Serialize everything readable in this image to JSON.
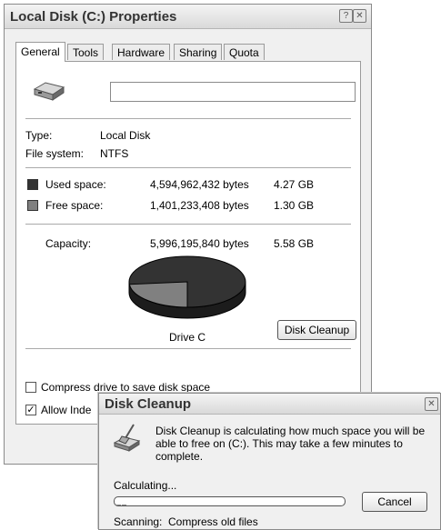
{
  "properties": {
    "title": "Local Disk (C:) Properties",
    "help_icon": "?",
    "close_icon": "✕",
    "tabs": [
      {
        "label": "General"
      },
      {
        "label": "Tools"
      },
      {
        "label": "Hardware"
      },
      {
        "label": "Sharing"
      },
      {
        "label": "Quota"
      }
    ],
    "active_tab": "General",
    "volume_label_value": "",
    "type_label": "Type:",
    "type_value": "Local Disk",
    "fs_label": "File system:",
    "fs_value": "NTFS",
    "used_label": "Used space:",
    "used_bytes": "4,594,962,432 bytes",
    "used_gb": "4.27 GB",
    "free_label": "Free space:",
    "free_bytes": "1,401,233,408 bytes",
    "free_gb": "1.30 GB",
    "capacity_label": "Capacity:",
    "capacity_bytes": "5,996,195,840 bytes",
    "capacity_gb": "5.58 GB",
    "drive_label": "Drive C",
    "disk_cleanup_button": "Disk Cleanup",
    "compress_label": "Compress drive to save disk space",
    "compress_checked": false,
    "index_label": "Allow Inde",
    "index_checked": true,
    "used_fraction": 0.766,
    "colors": {
      "used": "#333333",
      "free": "#808080"
    }
  },
  "cleanup": {
    "title": "Disk Cleanup",
    "close_icon": "✕",
    "message": "Disk Cleanup is calculating how much space you will be able to free on  (C:). This may take a few minutes to complete.",
    "calculating_label": "Calculating...",
    "cancel_button": "Cancel",
    "scanning_label": "Scanning:",
    "scanning_value": "Compress old files",
    "progress_blocks": 2
  }
}
